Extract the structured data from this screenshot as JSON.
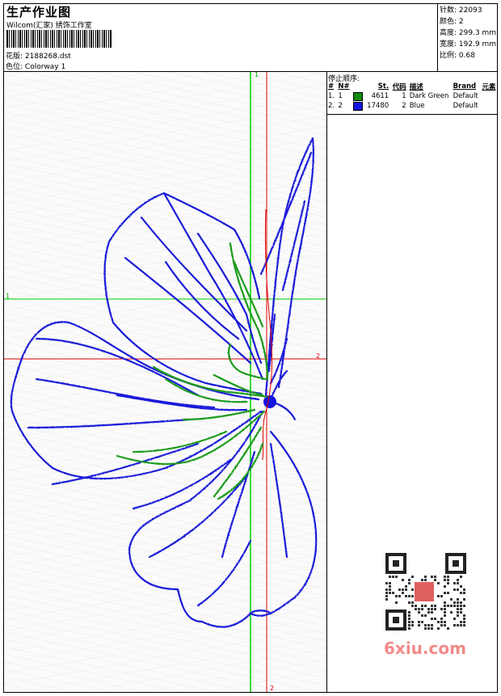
{
  "header": {
    "title": "生产作业图",
    "software": "Wilcom(汇家) 绣饰工作室",
    "design_label": "花版:",
    "design_file": "2188268.dst",
    "colorway_label": "色位:",
    "colorway": "Colorway 1"
  },
  "stats": {
    "stitches_label": "针数:",
    "stitches": "22093",
    "colors_label": "颜色:",
    "colors": "2",
    "height_label": "高度:",
    "height": "299.3 mm",
    "width_label": "宽度:",
    "width": "192.9 mm",
    "scale_label": "比例:",
    "scale": "0.68"
  },
  "stop_sequence": {
    "title": "停止顺序:",
    "columns": [
      "#",
      "N#",
      "St.",
      "代码",
      "描述",
      "Brand",
      "元素"
    ],
    "rows": [
      {
        "index": "1.",
        "n": "1",
        "color": "#0f8a0f",
        "stitches": "4611",
        "code": "1",
        "desc": "Dark Green",
        "brand": "Default"
      },
      {
        "index": "2.",
        "n": "2",
        "color": "#1414e0",
        "stitches": "17480",
        "code": "2",
        "desc": "Blue",
        "brand": "Default"
      }
    ]
  },
  "guides": {
    "v1": "1",
    "h1": "1",
    "h2": "2",
    "v2": "2"
  },
  "colors": {
    "blue_thread": "#1a1ad8",
    "green_thread": "#1a9a1a",
    "green_guide": "#00cc00",
    "red_guide": "#e00000",
    "watermark": "#f28a8a"
  },
  "watermark": {
    "text": "6xiu.com"
  }
}
